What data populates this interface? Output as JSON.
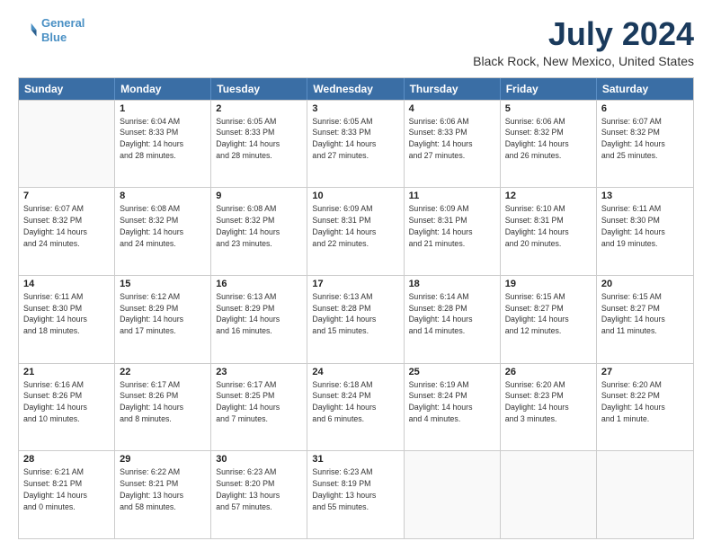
{
  "logo": {
    "line1": "General",
    "line2": "Blue"
  },
  "title": "July 2024",
  "subtitle": "Black Rock, New Mexico, United States",
  "header_days": [
    "Sunday",
    "Monday",
    "Tuesday",
    "Wednesday",
    "Thursday",
    "Friday",
    "Saturday"
  ],
  "weeks": [
    [
      {
        "day": "",
        "info": ""
      },
      {
        "day": "1",
        "info": "Sunrise: 6:04 AM\nSunset: 8:33 PM\nDaylight: 14 hours\nand 28 minutes."
      },
      {
        "day": "2",
        "info": "Sunrise: 6:05 AM\nSunset: 8:33 PM\nDaylight: 14 hours\nand 28 minutes."
      },
      {
        "day": "3",
        "info": "Sunrise: 6:05 AM\nSunset: 8:33 PM\nDaylight: 14 hours\nand 27 minutes."
      },
      {
        "day": "4",
        "info": "Sunrise: 6:06 AM\nSunset: 8:33 PM\nDaylight: 14 hours\nand 27 minutes."
      },
      {
        "day": "5",
        "info": "Sunrise: 6:06 AM\nSunset: 8:32 PM\nDaylight: 14 hours\nand 26 minutes."
      },
      {
        "day": "6",
        "info": "Sunrise: 6:07 AM\nSunset: 8:32 PM\nDaylight: 14 hours\nand 25 minutes."
      }
    ],
    [
      {
        "day": "7",
        "info": "Sunrise: 6:07 AM\nSunset: 8:32 PM\nDaylight: 14 hours\nand 24 minutes."
      },
      {
        "day": "8",
        "info": "Sunrise: 6:08 AM\nSunset: 8:32 PM\nDaylight: 14 hours\nand 24 minutes."
      },
      {
        "day": "9",
        "info": "Sunrise: 6:08 AM\nSunset: 8:32 PM\nDaylight: 14 hours\nand 23 minutes."
      },
      {
        "day": "10",
        "info": "Sunrise: 6:09 AM\nSunset: 8:31 PM\nDaylight: 14 hours\nand 22 minutes."
      },
      {
        "day": "11",
        "info": "Sunrise: 6:09 AM\nSunset: 8:31 PM\nDaylight: 14 hours\nand 21 minutes."
      },
      {
        "day": "12",
        "info": "Sunrise: 6:10 AM\nSunset: 8:31 PM\nDaylight: 14 hours\nand 20 minutes."
      },
      {
        "day": "13",
        "info": "Sunrise: 6:11 AM\nSunset: 8:30 PM\nDaylight: 14 hours\nand 19 minutes."
      }
    ],
    [
      {
        "day": "14",
        "info": "Sunrise: 6:11 AM\nSunset: 8:30 PM\nDaylight: 14 hours\nand 18 minutes."
      },
      {
        "day": "15",
        "info": "Sunrise: 6:12 AM\nSunset: 8:29 PM\nDaylight: 14 hours\nand 17 minutes."
      },
      {
        "day": "16",
        "info": "Sunrise: 6:13 AM\nSunset: 8:29 PM\nDaylight: 14 hours\nand 16 minutes."
      },
      {
        "day": "17",
        "info": "Sunrise: 6:13 AM\nSunset: 8:28 PM\nDaylight: 14 hours\nand 15 minutes."
      },
      {
        "day": "18",
        "info": "Sunrise: 6:14 AM\nSunset: 8:28 PM\nDaylight: 14 hours\nand 14 minutes."
      },
      {
        "day": "19",
        "info": "Sunrise: 6:15 AM\nSunset: 8:27 PM\nDaylight: 14 hours\nand 12 minutes."
      },
      {
        "day": "20",
        "info": "Sunrise: 6:15 AM\nSunset: 8:27 PM\nDaylight: 14 hours\nand 11 minutes."
      }
    ],
    [
      {
        "day": "21",
        "info": "Sunrise: 6:16 AM\nSunset: 8:26 PM\nDaylight: 14 hours\nand 10 minutes."
      },
      {
        "day": "22",
        "info": "Sunrise: 6:17 AM\nSunset: 8:26 PM\nDaylight: 14 hours\nand 8 minutes."
      },
      {
        "day": "23",
        "info": "Sunrise: 6:17 AM\nSunset: 8:25 PM\nDaylight: 14 hours\nand 7 minutes."
      },
      {
        "day": "24",
        "info": "Sunrise: 6:18 AM\nSunset: 8:24 PM\nDaylight: 14 hours\nand 6 minutes."
      },
      {
        "day": "25",
        "info": "Sunrise: 6:19 AM\nSunset: 8:24 PM\nDaylight: 14 hours\nand 4 minutes."
      },
      {
        "day": "26",
        "info": "Sunrise: 6:20 AM\nSunset: 8:23 PM\nDaylight: 14 hours\nand 3 minutes."
      },
      {
        "day": "27",
        "info": "Sunrise: 6:20 AM\nSunset: 8:22 PM\nDaylight: 14 hours\nand 1 minute."
      }
    ],
    [
      {
        "day": "28",
        "info": "Sunrise: 6:21 AM\nSunset: 8:21 PM\nDaylight: 14 hours\nand 0 minutes."
      },
      {
        "day": "29",
        "info": "Sunrise: 6:22 AM\nSunset: 8:21 PM\nDaylight: 13 hours\nand 58 minutes."
      },
      {
        "day": "30",
        "info": "Sunrise: 6:23 AM\nSunset: 8:20 PM\nDaylight: 13 hours\nand 57 minutes."
      },
      {
        "day": "31",
        "info": "Sunrise: 6:23 AM\nSunset: 8:19 PM\nDaylight: 13 hours\nand 55 minutes."
      },
      {
        "day": "",
        "info": ""
      },
      {
        "day": "",
        "info": ""
      },
      {
        "day": "",
        "info": ""
      }
    ]
  ]
}
